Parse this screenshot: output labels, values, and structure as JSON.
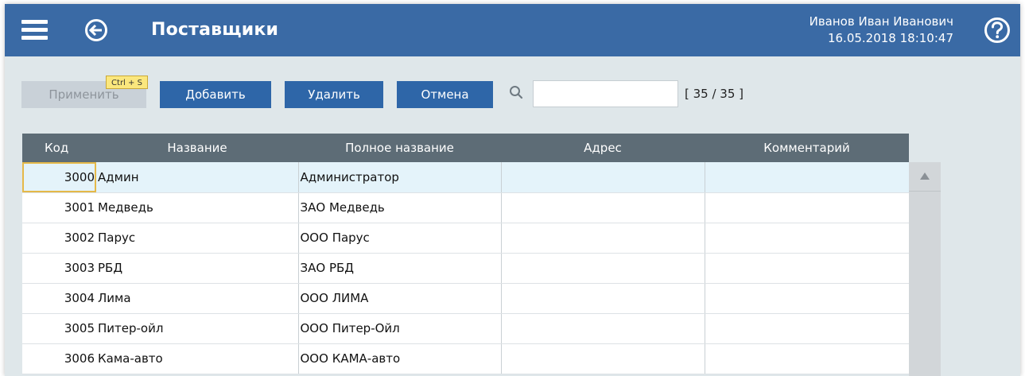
{
  "header": {
    "title": "Поставщики",
    "user_name": "Иванов Иван Иванович",
    "datetime": "16.05.2018 18:10:47"
  },
  "toolbar": {
    "apply_label": "Применить",
    "shortcut_hint": "Ctrl + S",
    "add_label": "Добавить",
    "delete_label": "Удалить",
    "cancel_label": "Отмена",
    "search_value": "",
    "counter": "[ 35 / 35 ]"
  },
  "table": {
    "columns": [
      "Код",
      "Название",
      "Полное название",
      "Адрес",
      "Комментарий"
    ],
    "rows": [
      {
        "code": "3000",
        "name": "Админ",
        "full_name": "Администратор",
        "address": "",
        "comment": ""
      },
      {
        "code": "3001",
        "name": "Медведь",
        "full_name": "ЗАО Медведь",
        "address": "",
        "comment": ""
      },
      {
        "code": "3002",
        "name": "Парус",
        "full_name": "ООО Парус",
        "address": "",
        "comment": ""
      },
      {
        "code": "3003",
        "name": "РБД",
        "full_name": "ЗАО РБД",
        "address": "",
        "comment": ""
      },
      {
        "code": "3004",
        "name": "Лима",
        "full_name": "ООО ЛИМА",
        "address": "",
        "comment": ""
      },
      {
        "code": "3005",
        "name": "Питер-ойл",
        "full_name": "ООО Питер-Ойл",
        "address": "",
        "comment": ""
      },
      {
        "code": "3006",
        "name": "Кама-авто",
        "full_name": "ООО КАМА-авто",
        "address": "",
        "comment": ""
      }
    ]
  },
  "icons": {
    "menu": "hamburger-menu-icon",
    "back": "back-arrow-icon",
    "help": "help-icon",
    "search": "search-icon",
    "scroll_up": "arrow-up-icon"
  },
  "colors": {
    "header_bg": "#3a6aa5",
    "button_bg": "#2e66a8",
    "table_header_bg": "#5d6c76",
    "selected_row_bg": "#e4f3fa",
    "selected_cell_border": "#e5b949",
    "page_bg": "#dfe7ea"
  }
}
